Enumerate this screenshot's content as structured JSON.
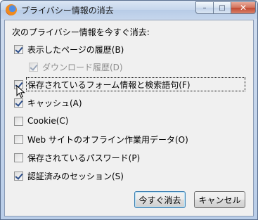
{
  "window": {
    "title": "プライバシー情報の消去",
    "controls": {
      "minimize": "–",
      "maximize": "□",
      "close": "✕"
    }
  },
  "dialog": {
    "heading": "次のプライバシー情報を今すぐ消去:",
    "items": [
      {
        "label": "表示したページの履歴(B)",
        "checked": true,
        "enabled": true
      },
      {
        "label": "ダウンロード履歴(D)",
        "checked": true,
        "enabled": false
      },
      {
        "label": "保存されているフォーム情報と検索語句(F)",
        "checked": true,
        "enabled": true,
        "focused": true
      },
      {
        "label": "キャッシュ(A)",
        "checked": true,
        "enabled": true
      },
      {
        "label": "Cookie(C)",
        "checked": false,
        "enabled": true
      },
      {
        "label": "Web サイトのオフライン作業用データ(O)",
        "checked": false,
        "enabled": true
      },
      {
        "label": "保存されているパスワード(P)",
        "checked": false,
        "enabled": true
      },
      {
        "label": "認証済みのセッション(S)",
        "checked": true,
        "enabled": true
      }
    ],
    "buttons": {
      "clear_now": "今すぐ消去",
      "cancel": "キャンセル"
    }
  }
}
